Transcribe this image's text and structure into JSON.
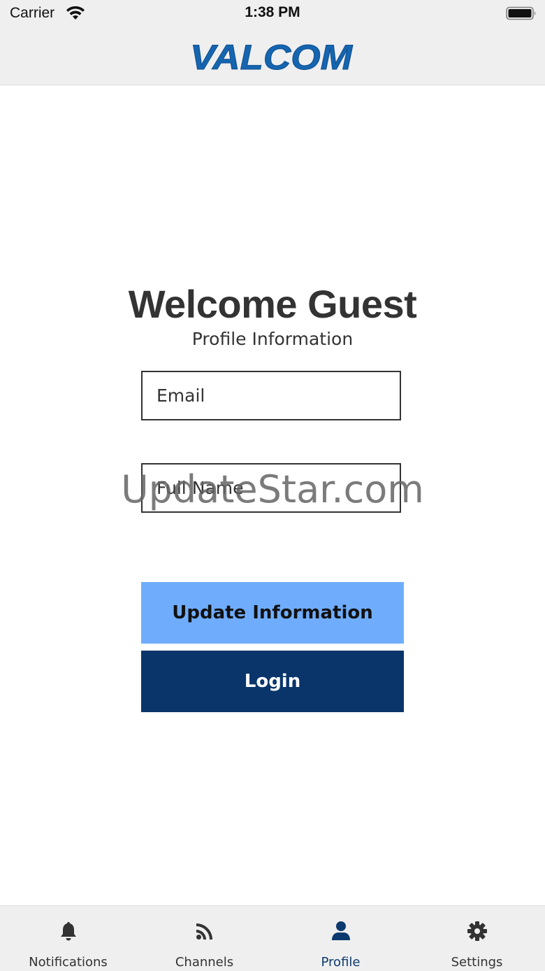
{
  "status_bar": {
    "carrier": "Carrier",
    "time": "1:38 PM",
    "wifi_icon": "wifi-icon",
    "battery_icon": "battery-icon"
  },
  "header": {
    "logo_text": "VALCOM",
    "logo_color": "#1565b0"
  },
  "main": {
    "title": "Welcome Guest",
    "subtitle": "Profile Information",
    "email_placeholder": "Email",
    "email_value": "",
    "fullname_placeholder": "Full Name",
    "fullname_value": "",
    "update_button": "Update Information",
    "login_button": "Login",
    "update_button_color": "#6fadfc",
    "login_button_color": "#09356b"
  },
  "watermark": "UpdateStar.com",
  "tab_bar": {
    "active_color": "#0d3a6e",
    "items": [
      {
        "label": "Notifications",
        "icon": "bell-icon",
        "active": false
      },
      {
        "label": "Channels",
        "icon": "rss-icon",
        "active": false
      },
      {
        "label": "Profile",
        "icon": "user-icon",
        "active": true
      },
      {
        "label": "Settings",
        "icon": "gear-icon",
        "active": false
      }
    ]
  }
}
